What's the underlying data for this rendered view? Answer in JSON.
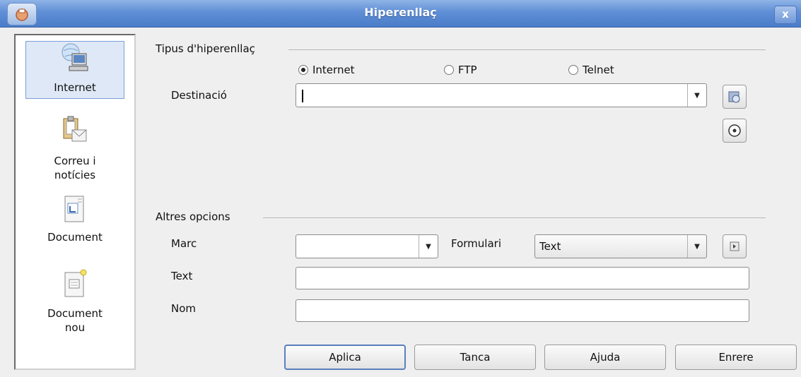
{
  "window": {
    "title": "Hiperenllaç",
    "close_glyph": "x"
  },
  "categories": [
    {
      "label": "Internet",
      "icon": "globe-computer-icon",
      "selected": true
    },
    {
      "label": "Correu i notícies",
      "label_line1": "Correu i",
      "label_line2": "notícies",
      "icon": "clipboard-mail-icon"
    },
    {
      "label": "Document",
      "icon": "document-icon"
    },
    {
      "label": "Document nou",
      "label_line1": "Document",
      "label_line2": "nou",
      "icon": "new-document-icon"
    }
  ],
  "hyperlink_type": {
    "title": "Tipus d'hiperenllaç",
    "options": [
      {
        "label": "Internet",
        "selected": true
      },
      {
        "label": "FTP",
        "selected": false
      },
      {
        "label": "Telnet",
        "selected": false
      }
    ],
    "destination_label": "Destinació",
    "destination_value": ""
  },
  "other_options": {
    "title": "Altres opcions",
    "frame_label": "Marc",
    "frame_value": "",
    "form_label": "Formulari",
    "form_value": "Text",
    "text_label": "Text",
    "text_value": "",
    "name_label": "Nom",
    "name_value": ""
  },
  "buttons": {
    "apply": "Aplica",
    "close": "Tanca",
    "help": "Ajuda",
    "back": "Enrere"
  },
  "colors": {
    "titlebar": "#5f8fd6",
    "selection": "#dfe8f6"
  }
}
